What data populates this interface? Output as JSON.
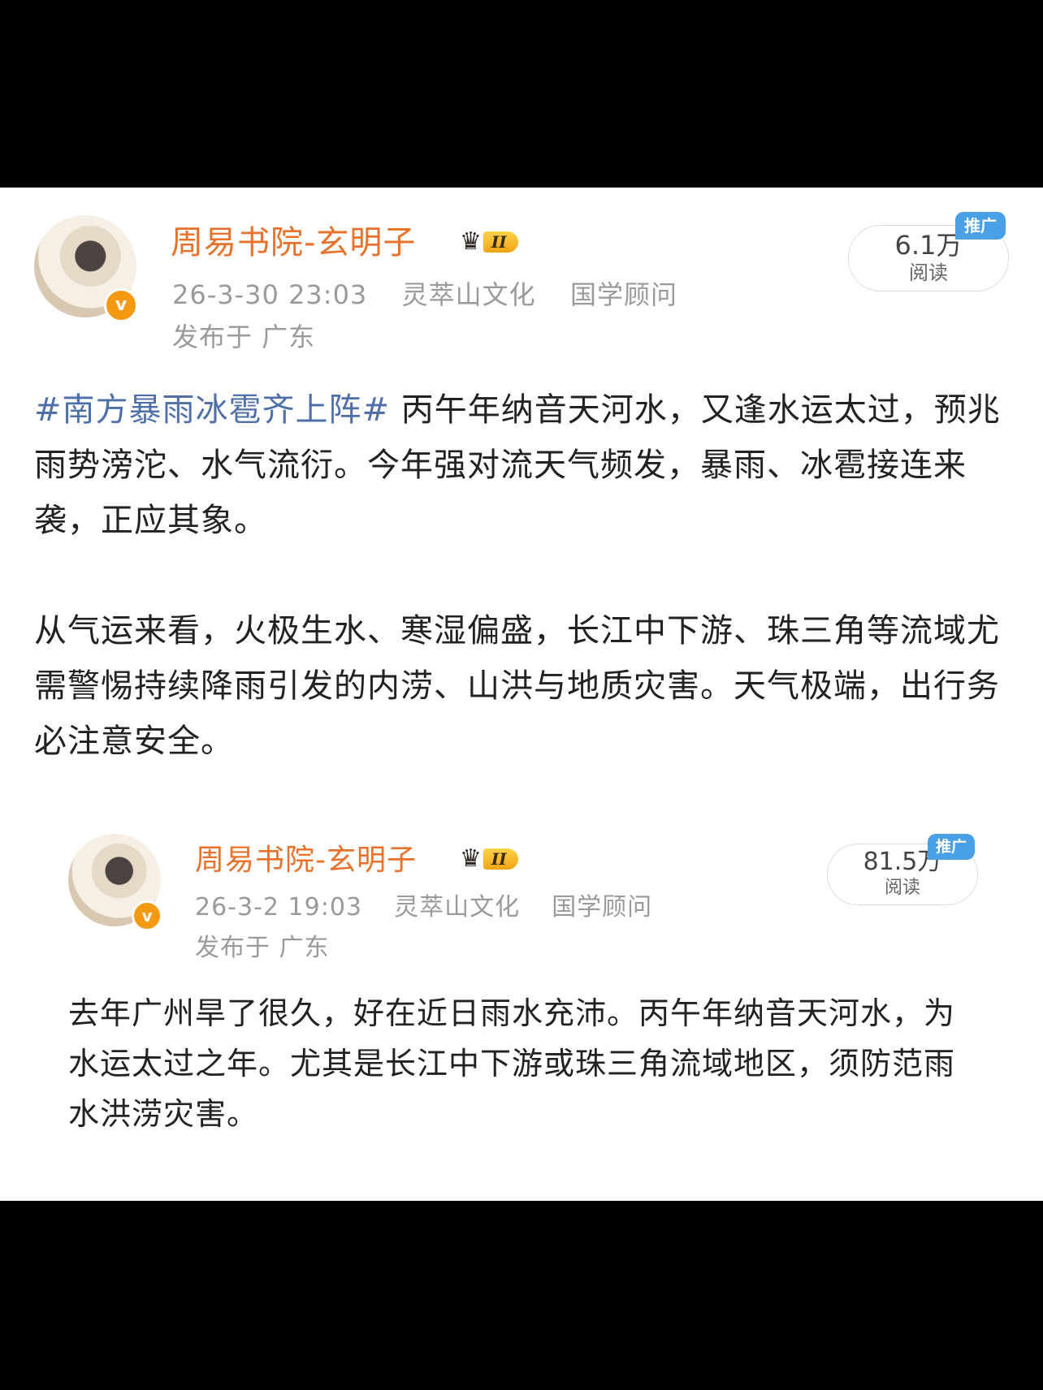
{
  "post": {
    "author": "周易书院-玄明子",
    "level_badge": "II",
    "timestamp": "26-3-30 23:03",
    "tags": [
      "灵萃山文化",
      "国学顾问"
    ],
    "location": "发布于 广东",
    "reads_count": "6.1万",
    "reads_label": "阅读",
    "promo_label": "推广",
    "hashtag": "#南方暴雨冰雹齐上阵#",
    "paragraph_1_rest": " 丙午年纳音天河水，又逢水运太过，预兆雨势滂沱、水气流衍。今年强对流天气频发，暴雨、冰雹接连来袭，正应其象。",
    "paragraph_2": "从气运来看，火极生水、寒湿偏盛，长江中下游、珠三角等流域尤需警惕持续降雨引发的内涝、山洪与地质灾害。天气极端，出行务必注意安全。"
  },
  "quoted_post": {
    "author": "周易书院-玄明子",
    "level_badge": "II",
    "timestamp": "26-3-2 19:03",
    "tags": [
      "灵萃山文化",
      "国学顾问"
    ],
    "location": "发布于 广东",
    "reads_count": "81.5万",
    "reads_label": "阅读",
    "promo_label": "推广",
    "text": "去年广州旱了很久，好在近日雨水充沛。丙午年纳音天河水，为水运太过之年。尤其是长江中下游或珠三角流域地区，须防范雨水洪涝灾害。"
  }
}
